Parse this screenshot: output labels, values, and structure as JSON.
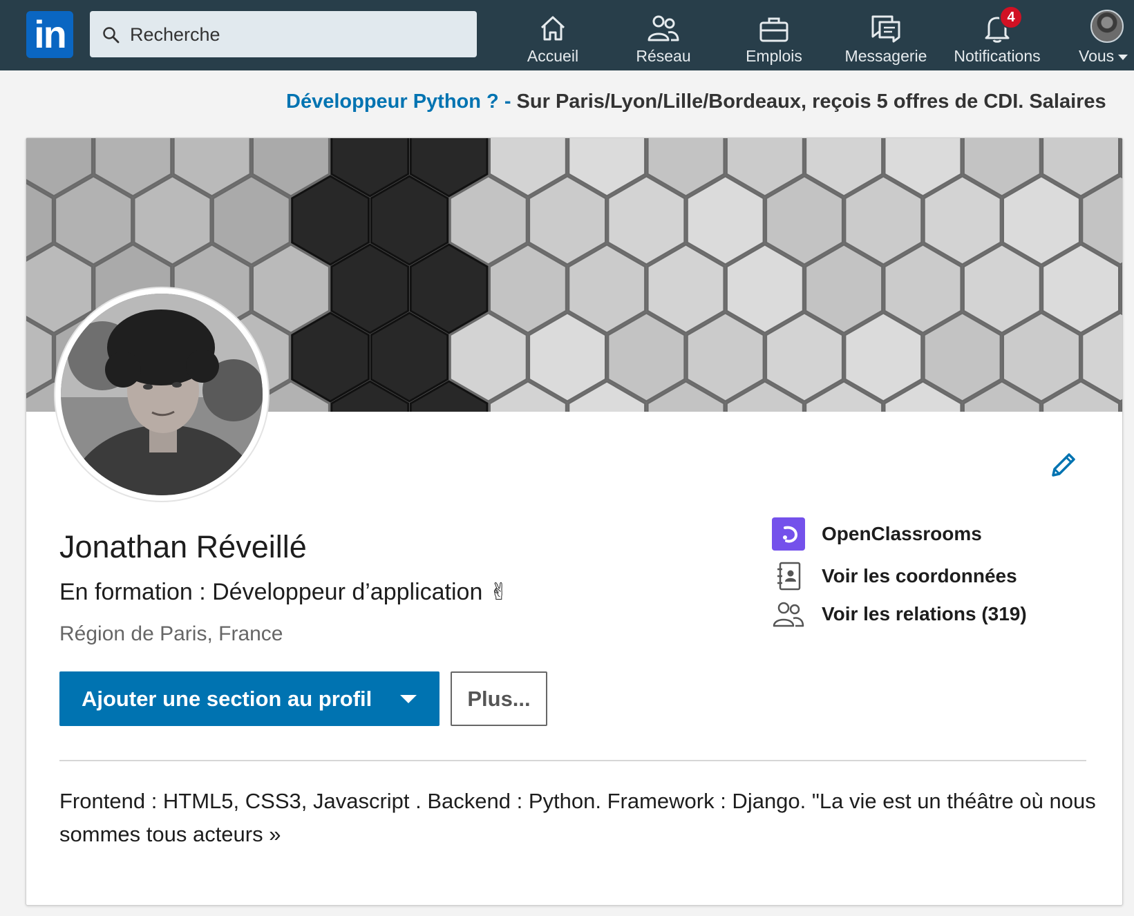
{
  "nav": {
    "logo_text": "in",
    "search_placeholder": "Recherche",
    "items": [
      {
        "label": "Accueil",
        "icon": "home-icon"
      },
      {
        "label": "Réseau",
        "icon": "network-icon"
      },
      {
        "label": "Emplois",
        "icon": "briefcase-icon"
      },
      {
        "label": "Messagerie",
        "icon": "messaging-icon"
      },
      {
        "label": "Notifications",
        "icon": "bell-icon",
        "badge": "4"
      },
      {
        "label": "Vous",
        "icon": "avatar"
      }
    ]
  },
  "promo": {
    "link": "Développeur Python ?",
    "separator": " - ",
    "text": "Sur Paris/Lyon/Lille/Bordeaux, reçois 5 offres de CDI. Salaires"
  },
  "profile": {
    "name": "Jonathan Réveillé",
    "headline": "En formation : Développeur d’application ✌",
    "location": "Région de Paris, France",
    "add_section_label": "Ajouter une section au profil",
    "more_label": "Plus...",
    "summary": "Frontend : HTML5, CSS3, Javascript . Backend : Python. Framework : Django. \"La vie est un théâtre où nous sommes tous acteurs »"
  },
  "sidebar": {
    "company": "OpenClassrooms",
    "contact": "Voir les coordonnées",
    "connections": "Voir les relations (319)"
  },
  "colors": {
    "nav_bg": "#283e4a",
    "primary": "#0073b1",
    "badge": "#d11124",
    "openclassrooms": "#7451eb"
  }
}
